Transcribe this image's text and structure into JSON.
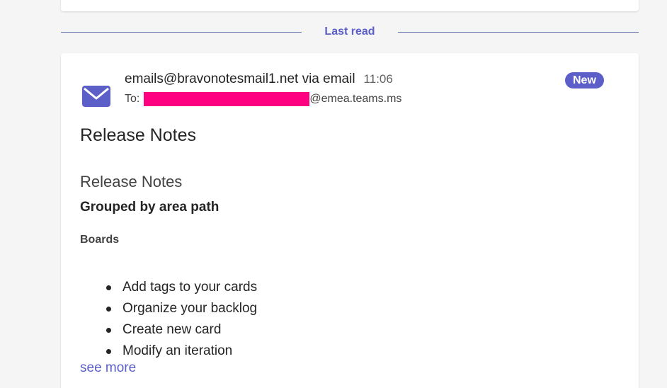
{
  "divider": {
    "label": "Last read"
  },
  "message": {
    "sender": "emails@bravonotesmail1.net via email",
    "time": "11:06",
    "to_label": "To:",
    "to_domain": "@emea.teams.ms",
    "badge": "New",
    "subject": "Release Notes",
    "body_heading": "Release Notes",
    "grouped_label": "Grouped by area path",
    "section_label": "Boards",
    "items": [
      "Add tags to your cards",
      "Organize your backlog",
      "Create new card",
      "Modify an iteration"
    ],
    "see_more": "see more"
  },
  "colors": {
    "accent": "#5b5fc7",
    "redaction": "#ff0080",
    "divider_line": "#5b6aa8"
  }
}
